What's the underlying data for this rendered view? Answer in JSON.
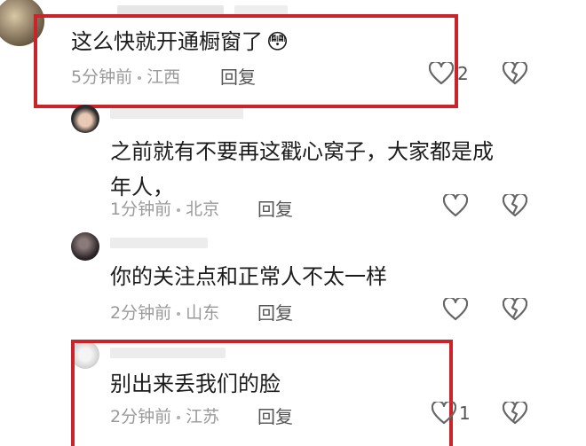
{
  "colors": {
    "highlight": "#c8242a",
    "meta": "#9a9a9a",
    "text": "#1c1c1c"
  },
  "comments": [
    {
      "text": "这么快就开通橱窗了",
      "emoji": "😳",
      "time": "5分钟前",
      "location": "江西",
      "reply": "回复",
      "likes": "2"
    },
    {
      "text_line1": "之前就有不要再这戳心窝子，大家都是成",
      "text_line2": "年人，",
      "time": "1分钟前",
      "location": "北京",
      "reply": "回复"
    },
    {
      "text": "你的关注点和正常人不太一样",
      "time": "2分钟前",
      "location": "山东",
      "reply": "回复"
    },
    {
      "text": "别出来丢我们的脸",
      "time": "2分钟前",
      "location": "江苏",
      "reply": "回复",
      "likes": "1"
    }
  ]
}
